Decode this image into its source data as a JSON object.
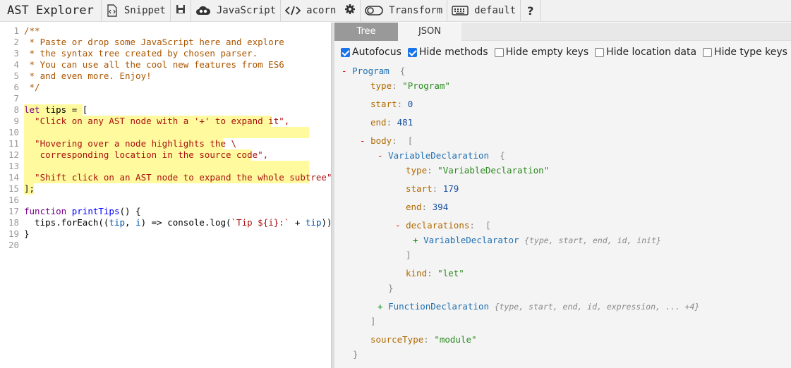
{
  "toolbar": {
    "brand": "AST Explorer",
    "snippet_label": "Snippet",
    "language_label": "JavaScript",
    "parser_label": "acorn",
    "transform_label": "Transform",
    "keymap_label": "default",
    "help_label": "?"
  },
  "editor": {
    "lines": [
      "1",
      "2",
      "3",
      "4",
      "5",
      "6",
      "7",
      "8",
      "9",
      "10",
      "11",
      "12",
      "13",
      "14",
      "15",
      "16",
      "17",
      "18",
      "19",
      "20"
    ],
    "comment": [
      "/**",
      " * Paste or drop some JavaScript here and explore",
      " * the syntax tree created by chosen parser.",
      " * You can use all the cool new features from ES6",
      " * and even more. Enjoy!",
      " */"
    ],
    "l8_kw": "let",
    "l8_rest": " tips = [",
    "l9": "  \"Click on any AST node with a '+' to expand it\",",
    "l11": "  \"Hovering over a node highlights the \\",
    "l12": "   corresponding location in the source code\",",
    "l14": "  \"Shift click on an AST node to expand the whole subtree\"",
    "l15": "];",
    "l17_kw": "function",
    "l17_name": "printTips",
    "l17_rest": "() {",
    "l18_a": "  tips.forEach((",
    "l18_tip": "tip",
    "l18_b": ", ",
    "l18_i": "i",
    "l18_c": ") => console.log(",
    "l18_tpl": "`Tip ${i}:`",
    "l18_d": " + ",
    "l18_tip2": "tip",
    "l18_e": "));",
    "l19": "}"
  },
  "output": {
    "tab_tree": "Tree",
    "tab_json": "JSON",
    "options": [
      {
        "label": "Autofocus",
        "checked": true
      },
      {
        "label": "Hide methods",
        "checked": true
      },
      {
        "label": "Hide empty keys",
        "checked": false
      },
      {
        "label": "Hide location data",
        "checked": false
      },
      {
        "label": "Hide type keys",
        "checked": false
      }
    ],
    "tree": {
      "program": "Program",
      "program_type_key": "type",
      "program_type_val": "\"Program\"",
      "start_key": "start",
      "start_val": "0",
      "end_key": "end",
      "end_val": "481",
      "body_key": "body",
      "vardecl": "VariableDeclaration",
      "vardecl_type_val": "\"VariableDeclaration\"",
      "vardecl_start_val": "179",
      "vardecl_end_val": "394",
      "declarations_key": "declarations",
      "declarator": "VariableDeclarator",
      "declarator_summary": "{type, start, end, id, init}",
      "kind_key": "kind",
      "kind_val": "\"let\"",
      "funcdecl": "FunctionDeclaration",
      "funcdecl_summary": "{type, start, end, id, expression, ... +4}",
      "sourcetype_key": "sourceType",
      "sourcetype_val": "\"module\""
    }
  },
  "colors": {
    "highlight": "#fffa9e",
    "tab_active_bg": "#999999",
    "checkbox_blue": "#1a73e8"
  },
  "icons": [
    "snippet-icon",
    "save-icon",
    "cloud-icon",
    "code-icon",
    "gear-icon",
    "toggle-icon",
    "keyboard-icon"
  ]
}
